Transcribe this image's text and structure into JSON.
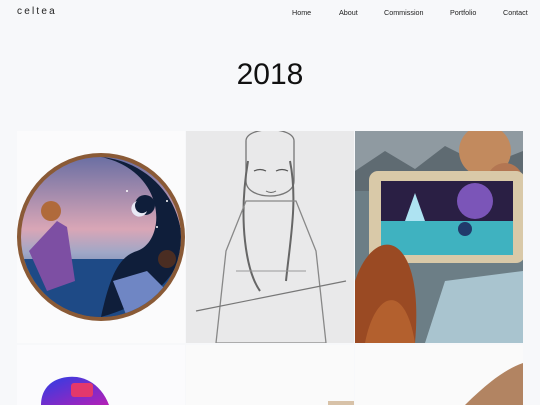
{
  "header": {
    "logo": "celtea",
    "nav": [
      {
        "label": "Home"
      },
      {
        "label": "About"
      },
      {
        "label": "Commission"
      },
      {
        "label": "Portfolio"
      },
      {
        "label": "Contact"
      }
    ]
  },
  "main": {
    "title": "2018"
  },
  "gallery": {
    "items": [
      {
        "icon": "circular-art-icon"
      },
      {
        "icon": "pencil-sketch-icon"
      },
      {
        "icon": "phone-art-icon"
      },
      {
        "icon": "gradient-art-icon"
      },
      {
        "icon": "art-thumbnail-icon"
      },
      {
        "icon": "hand-art-icon"
      }
    ]
  },
  "colors": {
    "background": "#f7f8fa",
    "text": "#222222"
  }
}
